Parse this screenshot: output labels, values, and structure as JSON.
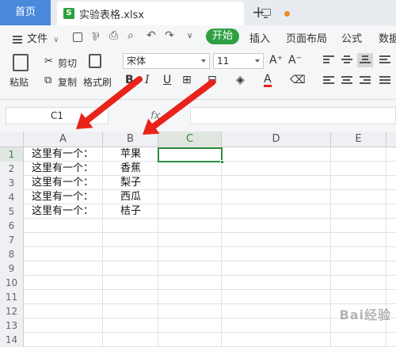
{
  "tabs": {
    "home": "首页",
    "file": "实验表格.xlsx",
    "new_tab": "+"
  },
  "menu": {
    "file_menu": "文件",
    "items": [
      "开始",
      "插入",
      "页面布局",
      "公式",
      "数据"
    ]
  },
  "ribbon": {
    "paste": "粘贴",
    "cut": "剪切",
    "copy": "复制",
    "format_painter": "格式刷",
    "font_name": "宋体",
    "font_size": "11",
    "grow_font": "A⁺",
    "shrink_font": "A⁻",
    "bold": "B",
    "italic": "I",
    "underline": "U",
    "font_color": "A"
  },
  "formula_bar": {
    "cell_ref": "C1",
    "fx": "fx",
    "formula": ""
  },
  "sheet": {
    "columns": [
      "A",
      "B",
      "C",
      "D",
      "E"
    ],
    "active_column": "C",
    "row_numbers": [
      "1",
      "2",
      "3",
      "4",
      "5",
      "6",
      "7",
      "8",
      "9",
      "10",
      "11",
      "12",
      "13",
      "14"
    ],
    "rows": [
      {
        "a": "这里有一个：",
        "b": "苹果"
      },
      {
        "a": "这里有一个：",
        "b": "香蕉"
      },
      {
        "a": "这里有一个：",
        "b": "梨子"
      },
      {
        "a": "这里有一个：",
        "b": "西瓜"
      },
      {
        "a": "这里有一个：",
        "b": "桔子"
      }
    ],
    "selected_cell": "C1"
  },
  "annotation": {
    "arrow_color": "#e8231a"
  },
  "watermark": "Bai经验"
}
